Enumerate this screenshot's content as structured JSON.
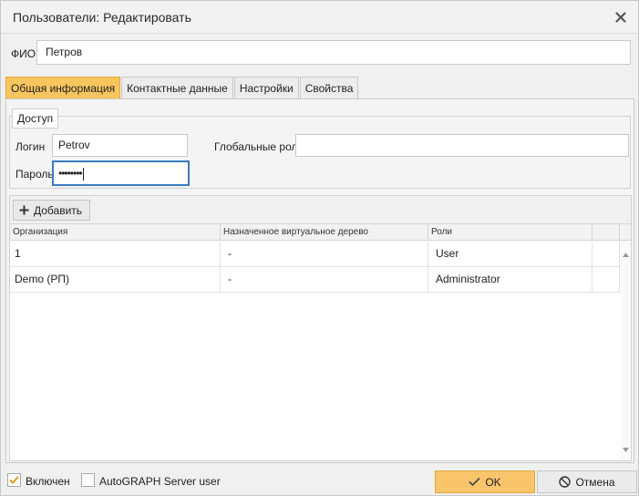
{
  "window": {
    "title": "Пользователи: Редактировать",
    "close_icon": "close-icon"
  },
  "fio": {
    "label": "ФИО",
    "value": "Петров"
  },
  "tabs": [
    {
      "label": "Общая информация",
      "active": true
    },
    {
      "label": "Контактные данные",
      "active": false
    },
    {
      "label": "Настройки",
      "active": false
    },
    {
      "label": "Свойства",
      "active": false
    }
  ],
  "access": {
    "legend": "Доступ",
    "login_label": "Логин",
    "login_value": "Petrov",
    "password_label": "Пароль",
    "password_value": "••••••••",
    "global_roles_label": "Глобальные роли",
    "global_roles_value": ""
  },
  "grid": {
    "add_button_label": "Добавить",
    "columns": [
      "Организация",
      "Назначенное виртуальное дерево",
      "Роли",
      ""
    ],
    "rows": [
      [
        "1",
        "-",
        "User",
        ""
      ],
      [
        "Demo (РП)",
        "-",
        "Administrator",
        ""
      ]
    ]
  },
  "footer": {
    "enabled_label": "Включен",
    "enabled_checked": true,
    "server_user_label": "AutoGRAPH Server user",
    "server_user_checked": false,
    "ok_label": "OK",
    "cancel_label": "Отмена"
  },
  "colors": {
    "accent": "#f9c55e",
    "focus": "#3a7bbf"
  }
}
